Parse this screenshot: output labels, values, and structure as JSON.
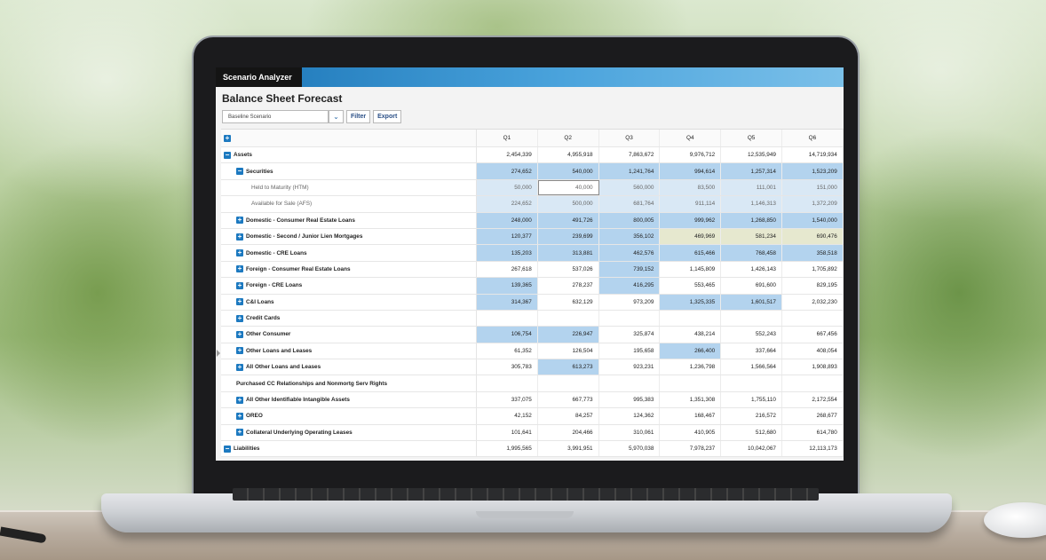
{
  "app": {
    "title": "Scenario Analyzer",
    "page_title": "Balance Sheet Forecast",
    "accent": "#1c79c0"
  },
  "toolbar": {
    "scenario": "Baseline Scenario",
    "filter_label": "Filter",
    "export_label": "Export"
  },
  "columns": [
    "Q1",
    "Q2",
    "Q3",
    "Q4",
    "Q5",
    "Q6"
  ],
  "rows": [
    {
      "label": "Assets",
      "level": 0,
      "toggle": "minus",
      "bold": true,
      "values": [
        "2,454,339",
        "4,955,918",
        "7,863,672",
        "9,976,712",
        "12,535,949",
        "14,719,934"
      ],
      "hl": [
        "",
        "",
        "",
        "",
        "",
        ""
      ]
    },
    {
      "label": "Securities",
      "level": 1,
      "toggle": "minus",
      "bold": true,
      "values": [
        "274,652",
        "540,000",
        "1,241,764",
        "994,614",
        "1,257,314",
        "1,523,209"
      ],
      "hl": [
        "hl",
        "hl",
        "hl",
        "hl",
        "hl",
        "hl"
      ]
    },
    {
      "label": "Held to Maturity (HTM)",
      "level": 2,
      "toggle": "",
      "bold": false,
      "values": [
        "50,000",
        "40,000",
        "560,000",
        "83,500",
        "111,001",
        "151,000"
      ],
      "hl": [
        "hl-light",
        "sel",
        "hl-light",
        "hl-light",
        "hl-light",
        "hl-light"
      ]
    },
    {
      "label": "Available for Sale (AFS)",
      "level": 2,
      "toggle": "",
      "bold": false,
      "values": [
        "224,652",
        "500,000",
        "681,764",
        "911,114",
        "1,146,313",
        "1,372,209"
      ],
      "hl": [
        "hl-light",
        "hl-light",
        "hl-light",
        "hl-light",
        "hl-light",
        "hl-light"
      ]
    },
    {
      "label": "Domestic - Consumer Real Estate Loans",
      "level": 1,
      "toggle": "plus",
      "bold": true,
      "values": [
        "248,000",
        "491,726",
        "800,005",
        "999,962",
        "1,268,850",
        "1,540,000"
      ],
      "hl": [
        "hl",
        "hl",
        "hl",
        "hl",
        "hl",
        "hl"
      ]
    },
    {
      "label": "Domestic - Second / Junior Lien Mortgages",
      "level": 1,
      "toggle": "plus",
      "bold": true,
      "values": [
        "120,377",
        "239,699",
        "356,102",
        "469,969",
        "581,234",
        "690,476"
      ],
      "hl": [
        "hl",
        "hl",
        "hl",
        "hl-yellow",
        "hl-yellow",
        "hl-yellow"
      ]
    },
    {
      "label": "Domestic - CRE Loans",
      "level": 1,
      "toggle": "plus",
      "bold": true,
      "values": [
        "135,203",
        "313,881",
        "462,576",
        "615,466",
        "768,458",
        "358,518"
      ],
      "hl": [
        "hl",
        "hl",
        "hl",
        "hl",
        "hl",
        "hl"
      ]
    },
    {
      "label": "Foreign - Consumer Real Estate Loans",
      "level": 1,
      "toggle": "plus",
      "bold": true,
      "values": [
        "267,618",
        "537,026",
        "739,152",
        "1,145,809",
        "1,426,143",
        "1,705,892"
      ],
      "hl": [
        "",
        "",
        "hl",
        "",
        "",
        ""
      ]
    },
    {
      "label": "Foreign - CRE Loans",
      "level": 1,
      "toggle": "plus",
      "bold": true,
      "values": [
        "139,365",
        "278,237",
        "416,295",
        "553,465",
        "691,600",
        "829,195"
      ],
      "hl": [
        "hl",
        "",
        "hl",
        "",
        "",
        ""
      ]
    },
    {
      "label": "C&I Loans",
      "level": 1,
      "toggle": "plus",
      "bold": true,
      "values": [
        "314,367",
        "632,129",
        "973,209",
        "1,325,335",
        "1,601,517",
        "2,032,230"
      ],
      "hl": [
        "hl",
        "",
        "",
        "hl",
        "hl",
        ""
      ]
    },
    {
      "label": "Credit Cards",
      "level": 1,
      "toggle": "plus",
      "bold": true,
      "values": [
        "",
        "",
        "",
        "",
        "",
        ""
      ],
      "hl": [
        "",
        "",
        "",
        "",
        "",
        ""
      ]
    },
    {
      "label": "Other Consumer",
      "level": 1,
      "toggle": "plus",
      "bold": true,
      "values": [
        "106,754",
        "226,947",
        "325,874",
        "438,214",
        "552,243",
        "667,456"
      ],
      "hl": [
        "hl",
        "hl",
        "",
        "",
        "",
        ""
      ]
    },
    {
      "label": "Other Loans and Leases",
      "level": 1,
      "toggle": "plus",
      "bold": true,
      "values": [
        "61,352",
        "126,504",
        "195,658",
        "266,400",
        "337,664",
        "408,054"
      ],
      "hl": [
        "",
        "",
        "",
        "hl",
        "",
        ""
      ]
    },
    {
      "label": "All Other Loans and Leases",
      "level": 1,
      "toggle": "plus",
      "bold": true,
      "values": [
        "305,783",
        "613,273",
        "923,231",
        "1,236,798",
        "1,566,564",
        "1,908,893"
      ],
      "hl": [
        "",
        "hl",
        "",
        "",
        "",
        ""
      ]
    },
    {
      "label": "Purchased CC Relationships and Nonmortg Serv Rights",
      "level": 1,
      "toggle": "",
      "bold": true,
      "values": [
        "",
        "",
        "",
        "",
        "",
        ""
      ],
      "hl": [
        "",
        "",
        "",
        "",
        "",
        ""
      ]
    },
    {
      "label": "All Other Identifiable Intangible Assets",
      "level": 1,
      "toggle": "plus",
      "bold": true,
      "values": [
        "337,075",
        "667,773",
        "995,383",
        "1,351,308",
        "1,755,110",
        "2,172,554"
      ],
      "hl": [
        "",
        "",
        "",
        "",
        "",
        ""
      ]
    },
    {
      "label": "OREO",
      "level": 1,
      "toggle": "plus",
      "bold": true,
      "values": [
        "42,152",
        "84,257",
        "124,362",
        "168,467",
        "216,572",
        "268,677"
      ],
      "hl": [
        "",
        "",
        "",
        "",
        "",
        ""
      ]
    },
    {
      "label": "Collateral Underlying Operating Leases",
      "level": 1,
      "toggle": "plus",
      "bold": true,
      "values": [
        "101,641",
        "204,466",
        "310,061",
        "410,905",
        "512,680",
        "614,780"
      ],
      "hl": [
        "",
        "",
        "",
        "",
        "",
        ""
      ]
    },
    {
      "label": "Liabilities",
      "level": 0,
      "toggle": "minus",
      "bold": true,
      "values": [
        "1,995,565",
        "3,991,951",
        "5,970,038",
        "7,978,237",
        "10,042,067",
        "12,113,173"
      ],
      "hl": [
        "",
        "",
        "",
        "",
        "",
        ""
      ]
    }
  ]
}
